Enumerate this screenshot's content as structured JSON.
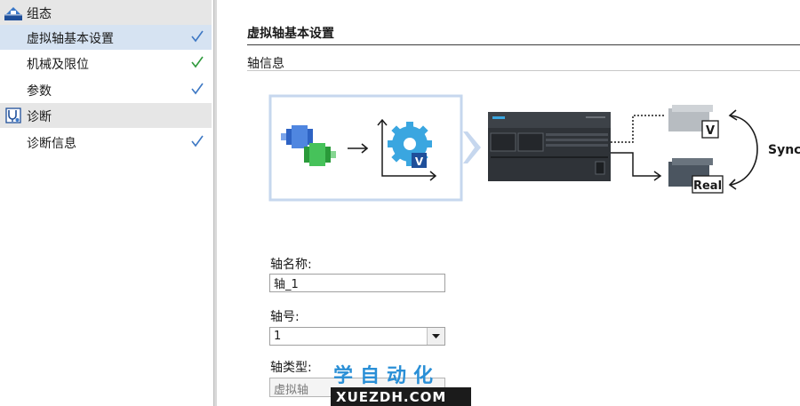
{
  "nav": {
    "groups": [
      {
        "label": "组态",
        "icon": "config-group-icon",
        "items": [
          {
            "label": "虚拟轴基本设置",
            "selected": true,
            "check_color": "#3d78c4"
          },
          {
            "label": "机械及限位",
            "selected": false,
            "check_color": "#2f9a3c"
          },
          {
            "label": "参数",
            "selected": false,
            "check_color": "#3d78c4"
          }
        ]
      },
      {
        "label": "诊断",
        "icon": "diagnostics-group-icon",
        "items": [
          {
            "label": "诊断信息",
            "selected": false,
            "check_color": "#3d78c4"
          }
        ]
      }
    ]
  },
  "main": {
    "section_title": "虚拟轴基本设置",
    "sub_title": "轴信息",
    "diagram": {
      "virtual_badge": "V",
      "remote_virtual_badge": "V",
      "remote_real_badge": "Real",
      "sync_label": "Sync"
    },
    "fields": {
      "axis_name_label": "轴名称:",
      "axis_name_value": "轴_1",
      "axis_number_label": "轴号:",
      "axis_number_value": "1",
      "axis_type_label": "轴类型:",
      "axis_type_value": "虚拟轴"
    }
  },
  "watermark": {
    "chinese": "学自动化",
    "url": "XUEZDH.COM"
  },
  "colors": {
    "selected_row": "#d6e3f2",
    "group_row": "#e6e6e6",
    "diagram_highlight": "#c6d7ee",
    "check_blue": "#3d78c4",
    "check_green": "#2f9a3c",
    "watermark_blue": "#2a8fd6"
  }
}
